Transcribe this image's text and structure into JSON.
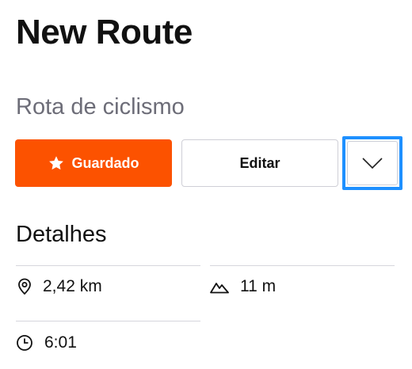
{
  "header": {
    "title": "New Route",
    "subtitle": "Rota de ciclismo"
  },
  "actions": {
    "saved_label": "Guardado",
    "edit_label": "Editar",
    "saved_color": "#fc5200",
    "focus_color": "#1e90ff"
  },
  "details": {
    "heading": "Detalhes",
    "distance": "2,42 km",
    "elevation": "11 m",
    "time": "6:01"
  },
  "icons": {
    "saved": "star-icon",
    "more": "chevron-down-icon",
    "distance": "map-pin-icon",
    "elevation": "mountain-icon",
    "time": "clock-icon"
  }
}
